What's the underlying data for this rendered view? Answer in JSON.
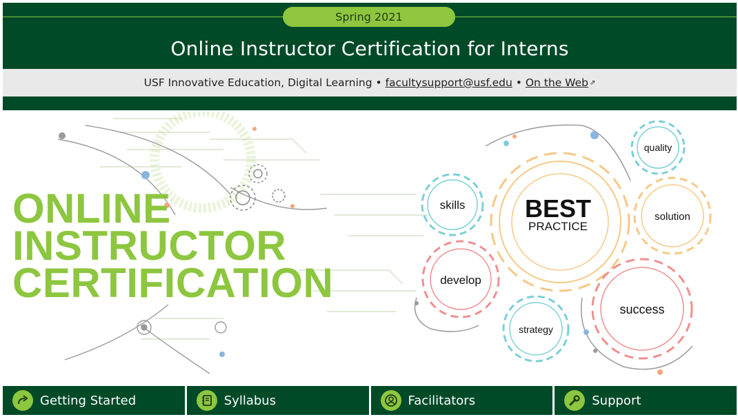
{
  "header": {
    "term_badge": "Spring 2021",
    "title": "Online Instructor Certification for Interns"
  },
  "subbar": {
    "org": "USF Innovative Education, Digital Learning",
    "separator": "•",
    "email": "facultysupport@usf.edu",
    "web_link": "On the Web"
  },
  "hero": {
    "title_lines": [
      "ONLINE",
      "INSTRUCTOR",
      "CERTIFICATION"
    ],
    "gears": {
      "best": "BEST",
      "practice": "PRACTICE",
      "skills": "skills",
      "quality": "quality",
      "solution": "solution",
      "develop": "develop",
      "strategy": "strategy",
      "success": "success"
    }
  },
  "nav": [
    {
      "label": "Getting Started",
      "icon": "arrow-forward-icon"
    },
    {
      "label": "Syllabus",
      "icon": "notebook-icon"
    },
    {
      "label": "Facilitators",
      "icon": "user-icon"
    },
    {
      "label": "Support",
      "icon": "wrench-icon"
    }
  ],
  "colors": {
    "dark_green": "#004a28",
    "lime_green": "#8dc63f",
    "gear_cyan": "#7ccfd6",
    "gear_orange": "#f5c987",
    "gear_red": "#ef8f8f"
  }
}
